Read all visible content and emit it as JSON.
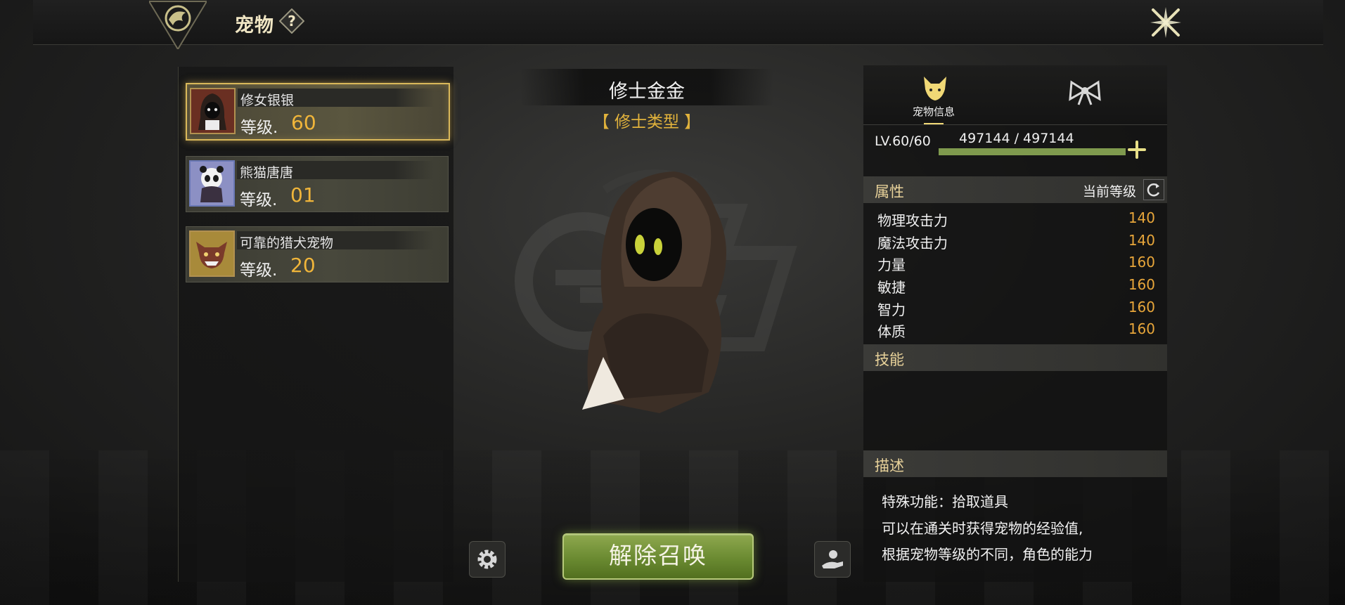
{
  "header": {
    "title": "宠物",
    "help_icon": "question-icon",
    "close_icon": "close-icon"
  },
  "pet_list": [
    {
      "name": "修女银银",
      "level_label": "等级.",
      "level": "60",
      "selected": true
    },
    {
      "name": "熊猫唐唐",
      "level_label": "等级.",
      "level": "01",
      "selected": false
    },
    {
      "name": "可靠的猎犬宠物",
      "level_label": "等级.",
      "level": "20",
      "selected": false
    }
  ],
  "center": {
    "pet_name": "修士金金",
    "pet_type": "【 修士类型 】",
    "dismiss_label": "解除召唤",
    "settings_icon": "gear-icon",
    "feed_icon": "hand-feed-icon"
  },
  "info_panel": {
    "tabs": [
      {
        "label": "宠物信息",
        "icon": "fox-head-icon",
        "active": true
      },
      {
        "label": "",
        "icon": "bow-icon",
        "active": false
      }
    ],
    "level_text": "LV.60/60",
    "exp_text": "497144 / 497144",
    "exp_fraction": 1.0,
    "attributes_title": "属性",
    "current_level_label": "当前等级",
    "stats": [
      {
        "name": "物理攻击力",
        "value": "140"
      },
      {
        "name": "魔法攻击力",
        "value": "140"
      },
      {
        "name": "力量",
        "value": "160"
      },
      {
        "name": "敏捷",
        "value": "160"
      },
      {
        "name": "智力",
        "value": "160"
      },
      {
        "name": "体质",
        "value": "160"
      }
    ],
    "skills_title": "技能",
    "description_title": "描述",
    "description_lines": [
      "特殊功能：拾取道具",
      "可以在通关时获得宠物的经验值,",
      "根据宠物等级的不同，角色的能力"
    ]
  },
  "colors": {
    "accent_gold": "#e2b33c",
    "level_orange": "#f0b53a",
    "stat_orange": "#e8a63a",
    "button_green": "#6a8a31"
  }
}
